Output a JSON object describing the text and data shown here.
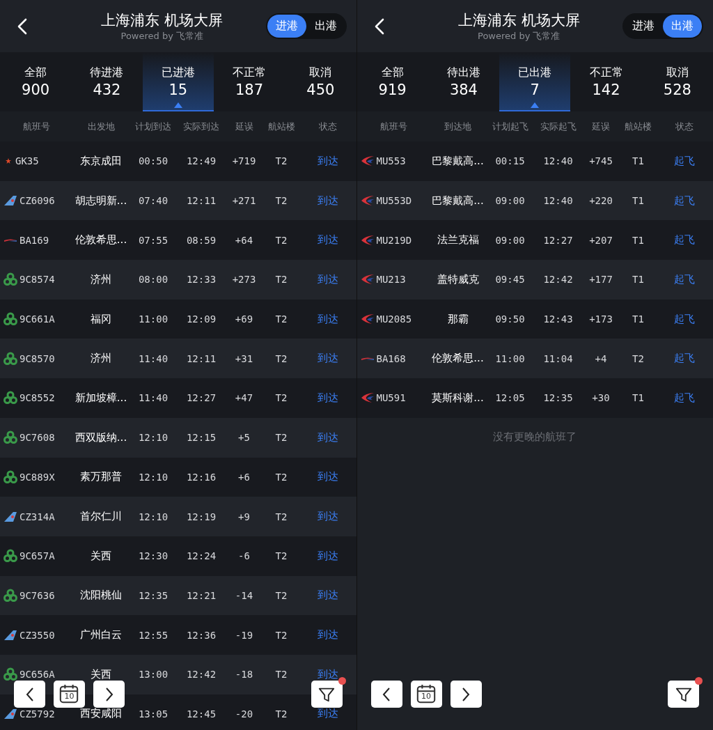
{
  "panels": [
    {
      "title": "上海浦东 机场大屏",
      "subtitle": "Powered by 飞常准",
      "toggle": [
        {
          "label": "进港",
          "selected": true
        },
        {
          "label": "出港",
          "selected": false
        }
      ],
      "stats": [
        {
          "label": "全部",
          "count": "900",
          "selected": false
        },
        {
          "label": "待进港",
          "count": "432",
          "selected": false
        },
        {
          "label": "已进港",
          "count": "15",
          "selected": true
        },
        {
          "label": "不正常",
          "count": "187",
          "selected": false
        },
        {
          "label": "取消",
          "count": "450",
          "selected": false
        }
      ],
      "columns": [
        "航班号",
        "出发地",
        "计划到达",
        "实际到达",
        "延误",
        "航站楼",
        "状态"
      ],
      "flights": [
        {
          "kind": "star",
          "flight": "GK35",
          "place": "东京成田",
          "scheduled": "00:50",
          "actual": "12:49",
          "delay": "+719",
          "terminal": "T2",
          "status": "到达"
        },
        {
          "kind": "fin",
          "flight": "CZ6096",
          "place": "胡志明新...",
          "scheduled": "07:40",
          "actual": "12:11",
          "delay": "+271",
          "terminal": "T2",
          "status": "到达"
        },
        {
          "kind": "stripe",
          "flight": "BA169",
          "place": "伦敦希思...",
          "scheduled": "07:55",
          "actual": "08:59",
          "delay": "+64",
          "terminal": "T2",
          "status": "到达"
        },
        {
          "kind": "trefoil",
          "flight": "9C8574",
          "place": "济州",
          "scheduled": "08:00",
          "actual": "12:33",
          "delay": "+273",
          "terminal": "T2",
          "status": "到达"
        },
        {
          "kind": "trefoil",
          "flight": "9C661A",
          "place": "福冈",
          "scheduled": "11:00",
          "actual": "12:09",
          "delay": "+69",
          "terminal": "T2",
          "status": "到达"
        },
        {
          "kind": "trefoil",
          "flight": "9C8570",
          "place": "济州",
          "scheduled": "11:40",
          "actual": "12:11",
          "delay": "+31",
          "terminal": "T2",
          "status": "到达"
        },
        {
          "kind": "trefoil",
          "flight": "9C8552",
          "place": "新加坡樟...",
          "scheduled": "11:40",
          "actual": "12:27",
          "delay": "+47",
          "terminal": "T2",
          "status": "到达"
        },
        {
          "kind": "trefoil",
          "flight": "9C7608",
          "place": "西双版纳...",
          "scheduled": "12:10",
          "actual": "12:15",
          "delay": "+5",
          "terminal": "T2",
          "status": "到达"
        },
        {
          "kind": "trefoil",
          "flight": "9C889X",
          "place": "素万那普",
          "scheduled": "12:10",
          "actual": "12:16",
          "delay": "+6",
          "terminal": "T2",
          "status": "到达"
        },
        {
          "kind": "fin",
          "flight": "CZ314A",
          "place": "首尔仁川",
          "scheduled": "12:10",
          "actual": "12:19",
          "delay": "+9",
          "terminal": "T2",
          "status": "到达"
        },
        {
          "kind": "trefoil",
          "flight": "9C657A",
          "place": "关西",
          "scheduled": "12:30",
          "actual": "12:24",
          "delay": "-6",
          "terminal": "T2",
          "status": "到达"
        },
        {
          "kind": "trefoil",
          "flight": "9C7636",
          "place": "沈阳桃仙",
          "scheduled": "12:35",
          "actual": "12:21",
          "delay": "-14",
          "terminal": "T2",
          "status": "到达"
        },
        {
          "kind": "fin",
          "flight": "CZ3550",
          "place": "广州白云",
          "scheduled": "12:55",
          "actual": "12:36",
          "delay": "-19",
          "terminal": "T2",
          "status": "到达"
        },
        {
          "kind": "trefoil",
          "flight": "9C656A",
          "place": "关西",
          "scheduled": "13:00",
          "actual": "12:42",
          "delay": "-18",
          "terminal": "T2",
          "status": "到达"
        },
        {
          "kind": "fin",
          "flight": "CZ5792",
          "place": "西安咸阳",
          "scheduled": "13:05",
          "actual": "12:45",
          "delay": "-20",
          "terminal": "T2",
          "status": "到达"
        }
      ],
      "controls": {
        "day": "10",
        "filter_badge": true
      }
    },
    {
      "title": "上海浦东 机场大屏",
      "subtitle": "Powered by 飞常准",
      "toggle": [
        {
          "label": "进港",
          "selected": false
        },
        {
          "label": "出港",
          "selected": true
        }
      ],
      "stats": [
        {
          "label": "全部",
          "count": "919",
          "selected": false
        },
        {
          "label": "待出港",
          "count": "384",
          "selected": false
        },
        {
          "label": "已出港",
          "count": "7",
          "selected": true
        },
        {
          "label": "不正常",
          "count": "142",
          "selected": false
        },
        {
          "label": "取消",
          "count": "528",
          "selected": false
        }
      ],
      "columns": [
        "航班号",
        "到达地",
        "计划起飞",
        "实际起飞",
        "延误",
        "航站楼",
        "状态"
      ],
      "flights": [
        {
          "kind": "swoosh",
          "flight": "MU553",
          "place": "巴黎戴高...",
          "scheduled": "00:15",
          "actual": "12:40",
          "delay": "+745",
          "terminal": "T1",
          "status": "起飞"
        },
        {
          "kind": "swoosh",
          "flight": "MU553D",
          "place": "巴黎戴高...",
          "scheduled": "09:00",
          "actual": "12:40",
          "delay": "+220",
          "terminal": "T1",
          "status": "起飞"
        },
        {
          "kind": "swoosh",
          "flight": "MU219D",
          "place": "法兰克福",
          "scheduled": "09:00",
          "actual": "12:27",
          "delay": "+207",
          "terminal": "T1",
          "status": "起飞"
        },
        {
          "kind": "swoosh",
          "flight": "MU213",
          "place": "盖特威克",
          "scheduled": "09:45",
          "actual": "12:42",
          "delay": "+177",
          "terminal": "T1",
          "status": "起飞"
        },
        {
          "kind": "swoosh",
          "flight": "MU2085",
          "place": "那霸",
          "scheduled": "09:50",
          "actual": "12:43",
          "delay": "+173",
          "terminal": "T1",
          "status": "起飞"
        },
        {
          "kind": "stripe",
          "flight": "BA168",
          "place": "伦敦希思...",
          "scheduled": "11:00",
          "actual": "11:04",
          "delay": "+4",
          "terminal": "T2",
          "status": "起飞"
        },
        {
          "kind": "swoosh",
          "flight": "MU591",
          "place": "莫斯科谢...",
          "scheduled": "12:05",
          "actual": "12:35",
          "delay": "+30",
          "terminal": "T1",
          "status": "起飞"
        }
      ],
      "footer_note": "没有更晚的航班了",
      "controls": {
        "day": "10",
        "filter_badge": true
      }
    }
  ]
}
